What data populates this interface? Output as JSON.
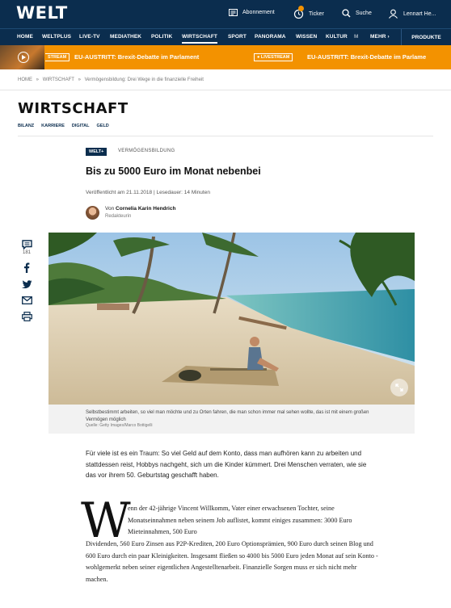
{
  "header": {
    "logo": "WELT",
    "abonnement": "Abonnement",
    "ticker": "Ticker",
    "suche": "Suche",
    "user": "Lennart He..."
  },
  "nav": {
    "items": [
      "HOME",
      "WELTPLUS",
      "LIVE-TV",
      "MEDIATHEK",
      "POLITIK",
      "WIRTSCHAFT",
      "SPORT",
      "PANORAMA",
      "WISSEN",
      "KULTUR",
      "M"
    ],
    "more": "MEHR ›",
    "produkte": "PRODUKTE"
  },
  "ticker": {
    "badge": "STREAM",
    "text_1": "EU-AUSTRITT: Brexit-Debatte im Parlament",
    "live_badge": "● LIVESTREAM",
    "text_2": "EU-AUSTRITT: Brexit-Debatte im Parlame"
  },
  "breadcrumb": [
    "HOME",
    "»",
    "WIRTSCHAFT",
    "»",
    "Vermögensbildung: Drei Wege in die finanzielle Freiheit"
  ],
  "section": {
    "title": "WIRTSCHAFT",
    "subnav": [
      "BILANZ",
      "KARRIERE",
      "DIGITAL",
      "GELD"
    ]
  },
  "article": {
    "plus_badge": "WELT+",
    "kicker": "VERMÖGENSBILDUNG",
    "headline": "Bis zu 5000 Euro im Monat nebenbei",
    "meta": "Veröffentlicht am 21.11.2018 | Lesedauer: 14 Minuten",
    "author_prefix": "Von",
    "author_name": "Cornelia Karin Hendrich",
    "author_role": "Redakteurin",
    "comment_count": "181",
    "caption": "Selbstbestimmt arbeiten, so viel man möchte und zu Orten fahren, die man schon immer mal sehen wollte, das ist mit einem großen Vermögen möglich",
    "credit": "Quelle: Getty Images/Marco Bottigelli",
    "teaser": "Für viele ist es ein Traum: So viel Geld auf dem Konto, dass man aufhören kann zu arbeiten und stattdessen reist, Hobbys nachgeht, sich um die Kinder kümmert. Drei Menschen verraten, wie sie das vor ihrem 50. Geburtstag geschafft haben.",
    "dropcap": "W",
    "body_first": "enn der 42-jährige Vincent Willkomm, Vater einer erwachsenen Tochter, seine Monatseinnahmen neben seinem Job auflistet, kommt einiges zusammen: 3000 Euro Mieteinnahmen, 500 Euro",
    "body_rest": "Dividenden, 560 Euro Zinsen aus P2P-Krediten, 200 Euro Optionsprämien, 900 Euro durch seinen Blog und 600 Euro durch ein paar Kleinigkeiten. Insgesamt fließen so 4000 bis 5000 Euro jeden Monat auf sein Konto - wohlgemerkt neben seiner eigentlichen Angestelltenarbeit. Finanzielle Sorgen muss er sich nicht mehr machen."
  },
  "colors": {
    "navy": "#0b2d4e",
    "ticker_orange": "#f39200"
  }
}
